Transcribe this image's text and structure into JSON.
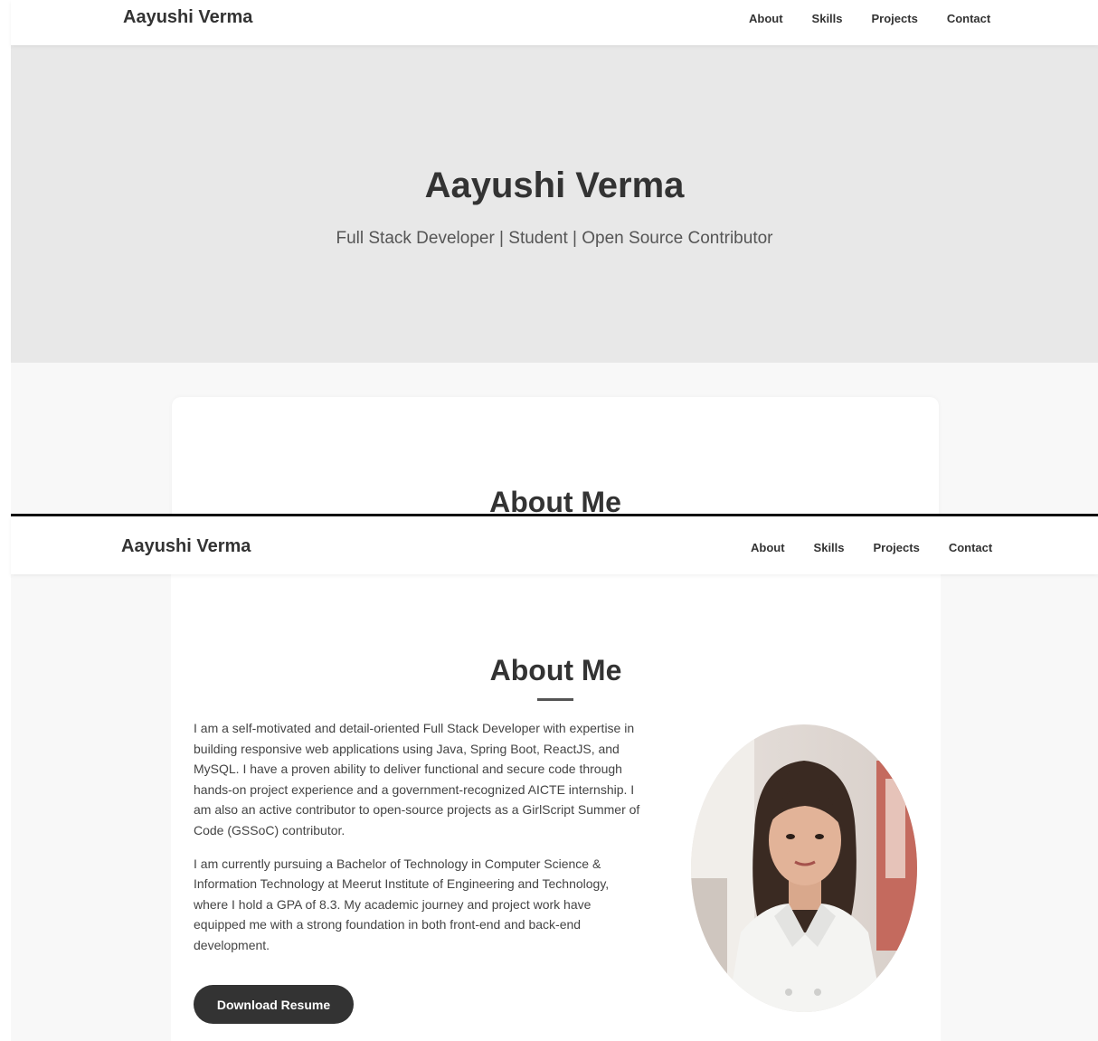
{
  "navbar": {
    "brand": "Aayushi Verma",
    "links": [
      "About",
      "Skills",
      "Projects",
      "Contact"
    ]
  },
  "hero": {
    "title": "Aayushi Verma",
    "subtitle": "Full Stack Developer | Student | Open Source Contributor"
  },
  "about": {
    "title": "About Me",
    "paragraphs": [
      "I am a self-motivated and detail-oriented Full Stack Developer with expertise in building responsive web applications using Java, Spring Boot, ReactJS, and MySQL. I have a proven ability to deliver functional and secure code through hands-on project experience and a government-recognized AICTE internship. I am also an active contributor to open-source projects as a GirlScript Summer of Code (GSSoC) contributor.",
      "I am currently pursuing a Bachelor of Technology in Computer Science & Information Technology at Meerut Institute of Engineering and Technology, where I hold a GPA of 8.3. My academic journey and project work have equipped me with a strong foundation in both front-end and back-end development."
    ],
    "resume_button": "Download Resume",
    "photo_icon": "profile-photo"
  },
  "colors": {
    "hero_bg": "#e8e8e8",
    "section_bg": "#f8f8f8",
    "text": "#333333",
    "button_bg": "#333333"
  }
}
